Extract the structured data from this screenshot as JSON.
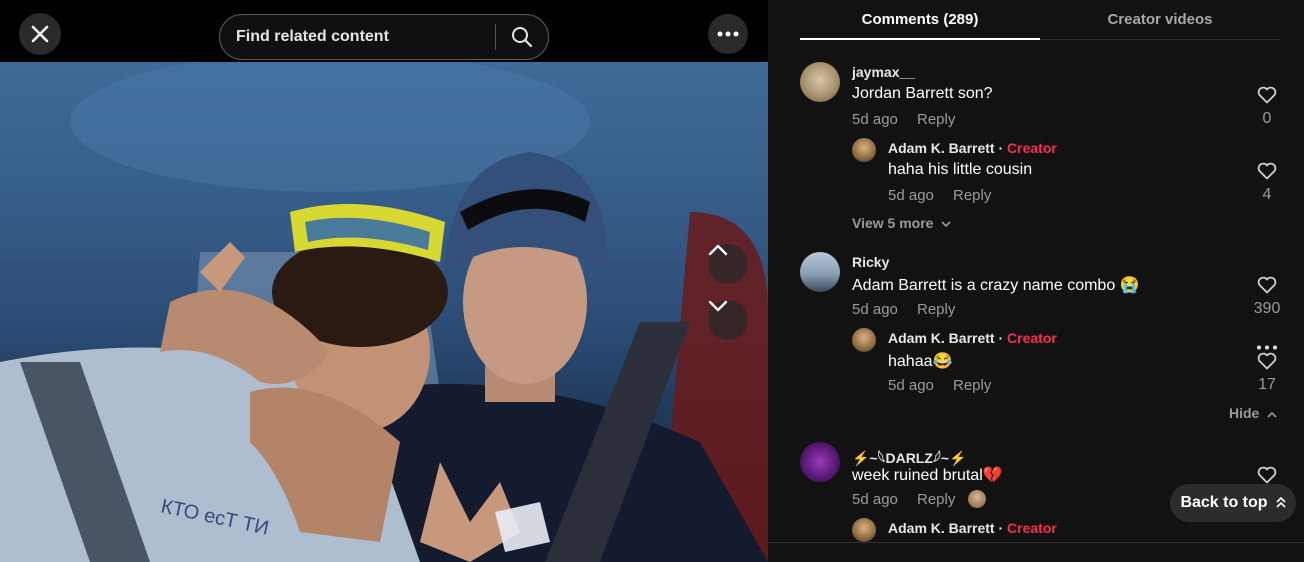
{
  "search": {
    "placeholder": "Find related content"
  },
  "icons": {
    "close": "close-icon",
    "search": "search-icon",
    "more": "more-horizontal-icon",
    "up": "chevron-up-icon",
    "down": "chevron-down-icon",
    "heart": "heart-outline-icon"
  },
  "colors": {
    "accent": "#fe2c55",
    "background": "#121212"
  },
  "tabs": [
    {
      "label": "Comments (289)",
      "active": true
    },
    {
      "label": "Creator videos",
      "active": false
    }
  ],
  "comments": [
    {
      "user": "jaymax__",
      "text": "Jordan Barrett son?",
      "time": "5d ago",
      "reply": "Reply",
      "likes": "0",
      "replies": [
        {
          "user": "Adam K. Barrett",
          "sep": " · ",
          "badge": "Creator",
          "text": "haha his little cousin",
          "time": "5d ago",
          "reply": "Reply",
          "likes": "4"
        }
      ],
      "view_more": "View 5 more"
    },
    {
      "user": "Ricky",
      "text": "Adam Barrett is a crazy name combo 😭",
      "time": "5d ago",
      "reply": "Reply",
      "likes": "390",
      "replies": [
        {
          "user": "Adam K. Barrett",
          "sep": " · ",
          "badge": "Creator",
          "text": "hahaa😂",
          "time": "5d ago",
          "reply": "Reply",
          "likes": "17"
        }
      ],
      "hide": "Hide"
    },
    {
      "user": "⚡~𓆩DARLZ𓆪~⚡",
      "text": "week ruined brutal💔",
      "time": "5d ago",
      "reply": "Reply",
      "replies": [
        {
          "user": "Adam K. Barrett",
          "sep": " · ",
          "badge": "Creator"
        }
      ]
    }
  ],
  "back_to_top": "Back to top"
}
